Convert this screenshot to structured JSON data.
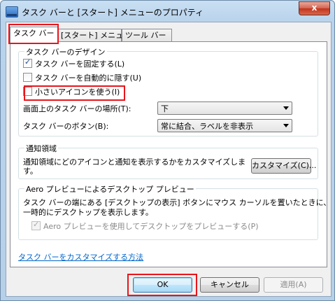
{
  "window": {
    "title": "タスク バーと [スタート] メニューのプロパティ",
    "close_label": "x"
  },
  "tabs": [
    {
      "label": "タスク バー",
      "active": true
    },
    {
      "label": "[スタート] メニュー",
      "active": false
    },
    {
      "label": "ツール バー",
      "active": false
    }
  ],
  "appearance": {
    "title": "タスク バーのデザイン",
    "checkboxes": [
      {
        "label": "タスク バーを固定する(L)",
        "checked": true
      },
      {
        "label": "タスク バーを自動的に隠す(U)",
        "checked": false
      },
      {
        "label": "小さいアイコンを使う(I)",
        "checked": false
      }
    ],
    "location_label": "画面上のタスク バーの場所(T):",
    "location_value": "下",
    "buttons_label": "タスク バーのボタン(B):",
    "buttons_value": "常に結合、ラベルを非表示"
  },
  "notification": {
    "title": "通知領域",
    "description": "通知領域にどのアイコンと通知を表示するかをカスタマイズします。",
    "customize_button": "カスタマイズ(C)..."
  },
  "aero": {
    "title": "Aero プレビューによるデスクトップ プレビュー",
    "description_line1": "タスク バーの端にある [デスクトップの表示] ボタンにマウス カーソルを置いたときに、",
    "description_line2": "一時的にデスクトップを表示します。",
    "checkbox_label": "Aero プレビューを使用してデスクトップをプレビューする(P)",
    "checkbox_checked": true,
    "checkbox_disabled": true
  },
  "help_link": "タスク バーをカスタマイズする方法",
  "footer": {
    "ok": "OK",
    "cancel": "キャンセル",
    "apply": "適用(A)"
  },
  "highlight_color": "#e8151b"
}
